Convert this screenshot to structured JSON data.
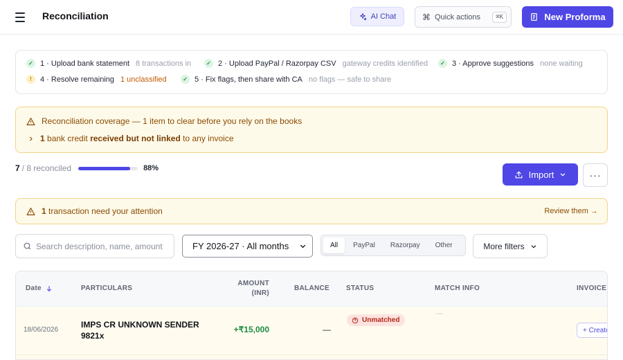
{
  "header": {
    "title": "Reconciliation",
    "ai_chat_label": "AI Chat",
    "quick_actions_label": "Quick actions",
    "quick_actions_shortcut": "⌘K",
    "new_proforma_label": "New Proforma"
  },
  "steps": [
    {
      "label": "1 · Upload bank statement",
      "note": "8 transactions in",
      "state": "done"
    },
    {
      "label": "2 · Upload PayPal / Razorpay CSV",
      "note": "gateway credits identified",
      "state": "done"
    },
    {
      "label": "3 · Approve suggestions",
      "note": "none waiting",
      "state": "done"
    },
    {
      "label": "4 · Resolve remaining",
      "note": "1 unclassified",
      "state": "warning"
    },
    {
      "label": "5 · Fix flags, then share with CA",
      "note": "no flags — safe to share",
      "state": "done"
    }
  ],
  "coverage": {
    "title": "Reconciliation coverage — 1 item to clear before you rely on the books",
    "count": "1",
    "text_before": "bank credit",
    "text_bold": "received but not linked",
    "text_after": "to any invoice"
  },
  "progress": {
    "reconciled": "7",
    "total_text": "/ 8 reconciled",
    "percent_label": "88%",
    "fraction": 0.875
  },
  "actions": {
    "import_label": "Import",
    "more_label": "···"
  },
  "attention": {
    "count": "1",
    "text": "transaction need your attention",
    "link": "Review them →"
  },
  "filters": {
    "search_placeholder": "Search description, name, amount",
    "fy_value": "FY 2026-27 · All months",
    "segments": [
      "All",
      "PayPal",
      "Razorpay",
      "Other"
    ],
    "active_segment": "All",
    "more_filters_label": "More filters"
  },
  "table": {
    "columns": {
      "date": "Date",
      "particulars": "PARTICULARS",
      "amount_line1": "AMOUNT",
      "amount_line2": "(INR)",
      "balance": "BALANCE",
      "status": "STATUS",
      "match_info": "MATCH INFO",
      "invoice": "INVOICE"
    },
    "rows": [
      {
        "date": "18/06/2026",
        "particulars_line1": "IMPS CR UNKNOWN SENDER",
        "particulars_line2": "9821x",
        "amount": "+₹15,000",
        "balance": "—",
        "status": "Unmatched",
        "match_info": "—",
        "invoice_action": "+ Create"
      }
    ]
  },
  "colors": {
    "accent": "#4e46e5",
    "warning_bg": "#fefaea",
    "warning_border": "#f1d48a",
    "success": "#1d8b45",
    "danger": "#b42a1a"
  }
}
